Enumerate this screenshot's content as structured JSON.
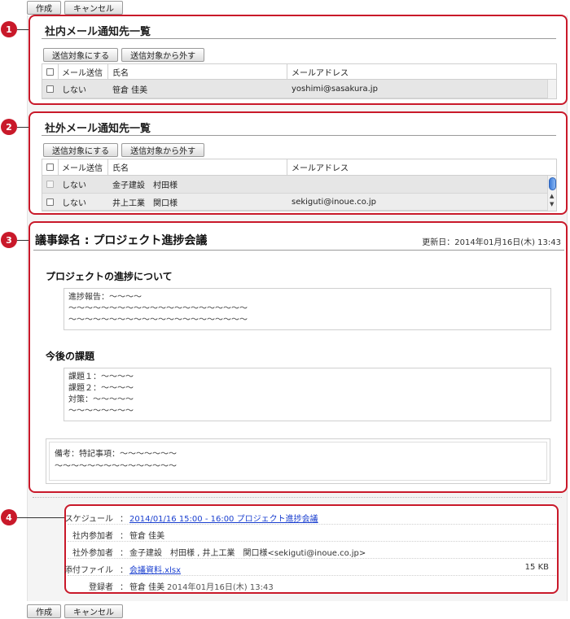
{
  "toolbar": {
    "create_label": "作成",
    "cancel_label": "キャンセル"
  },
  "callouts": [
    "1",
    "2",
    "3",
    "4"
  ],
  "internal": {
    "title": "社内メール通知先一覧",
    "send_button": "送信対象にする",
    "remove_button": "送信対象から外す",
    "headers": {
      "send": "メール送信",
      "name": "氏名",
      "email": "メールアドレス"
    },
    "rows": [
      {
        "send": "しない",
        "name": "笹倉 佳美",
        "email": "yoshimi@sasakura.jp"
      }
    ]
  },
  "external": {
    "title": "社外メール通知先一覧",
    "send_button": "送信対象にする",
    "remove_button": "送信対象から外す",
    "headers": {
      "send": "メール送信",
      "name": "氏名",
      "email": "メールアドレス"
    },
    "rows": [
      {
        "send": "しない",
        "name": "金子建設　村田様",
        "email": ""
      },
      {
        "send": "しない",
        "name": "井上工業　関口様",
        "email": "sekiguti@inoue.co.jp"
      }
    ]
  },
  "minutes": {
    "title": "議事録名 : プロジェクト進捗会議",
    "updated": "更新日：2014年01月16日(木) 13:43",
    "sections": [
      {
        "heading": "プロジェクトの進捗について",
        "body": "進捗報告：〜〜〜〜\n〜〜〜〜〜〜〜〜〜〜〜〜〜〜〜〜〜〜〜〜〜〜\n〜〜〜〜〜〜〜〜〜〜〜〜〜〜〜〜〜〜〜〜〜〜"
      },
      {
        "heading": "今後の課題",
        "body": "課題１：〜〜〜〜\n課題２：〜〜〜〜\n対策：〜〜〜〜〜\n〜〜〜〜〜〜〜〜"
      }
    ],
    "note": "備考：特記事項：〜〜〜〜〜〜〜\n〜〜〜〜〜〜〜〜〜〜〜〜〜〜〜"
  },
  "info": {
    "schedule": {
      "label": "スケジュール",
      "value": "2014/01/16 15:00 - 16:00 プロジェクト進捗会議"
    },
    "internal_participants": {
      "label": "社内参加者",
      "value": "笹倉 佳美"
    },
    "external_participants": {
      "label": "社外参加者",
      "value": "金子建設　村田様 , 井上工業　関口様<sekiguti@inoue.co.jp>"
    },
    "attachment": {
      "label": "添付ファイル",
      "value": "会議資料.xlsx",
      "size": "15 KB"
    },
    "registrant": {
      "label": "登録者",
      "name": "笹倉 佳美",
      "date": "2014年01月16日(木) 13:43"
    },
    "colon": "："
  }
}
